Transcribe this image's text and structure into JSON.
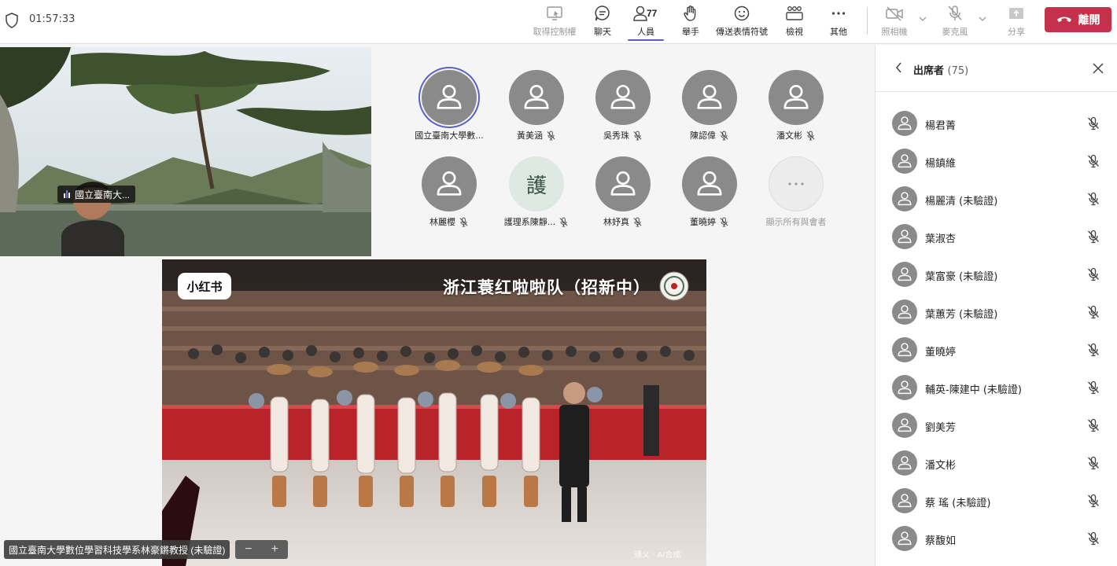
{
  "meeting": {
    "timer": "01:57:33"
  },
  "toolbar": {
    "take_control": "取得控制權",
    "chat": "聊天",
    "people": "人員",
    "people_count": "77",
    "raise_hand": "舉手",
    "reactions": "傳送表情符號",
    "view": "檢視",
    "more": "其他",
    "camera": "照相機",
    "mic": "麥克風",
    "share": "分享",
    "leave": "離開"
  },
  "video1": {
    "label": "國立臺南大..."
  },
  "participants": [
    {
      "name": "國立臺南大學數...",
      "muted": false,
      "active": true
    },
    {
      "name": "黃美涵",
      "muted": true
    },
    {
      "name": "吳秀珠",
      "muted": true
    },
    {
      "name": "陳認偉",
      "muted": true
    },
    {
      "name": "潘文彬",
      "muted": true
    },
    {
      "name": "林麗櫻",
      "muted": true
    },
    {
      "name": "護理系陳靜...",
      "muted": true,
      "avatar_text": "護"
    },
    {
      "name": "林妤真",
      "muted": true
    },
    {
      "name": "董曉婷",
      "muted": true
    },
    {
      "name": "顯示所有與會者",
      "more": true
    }
  ],
  "video2": {
    "brand": "小红书",
    "title": "浙江蓑红啦啦队（招新中）",
    "ai_mark": "通义 · AI合成"
  },
  "presenter": {
    "label": "國立臺南大學數位學習科技學系林豪鏘教授 (未驗證)",
    "zoom_out": "−",
    "zoom_in": "+"
  },
  "panel": {
    "title": "出席者",
    "count": "(75)",
    "attendees": [
      "楊君菁",
      "楊鎮維",
      "楊麗清 (未驗證)",
      "葉淑杏",
      "葉富豪 (未驗證)",
      "葉蕙芳 (未驗證)",
      "董曉婷",
      "輔英-陳建中 (未驗證)",
      "劉美芳",
      "潘文彬",
      "蔡 瑤 (未驗證)",
      "蔡馥如"
    ]
  }
}
